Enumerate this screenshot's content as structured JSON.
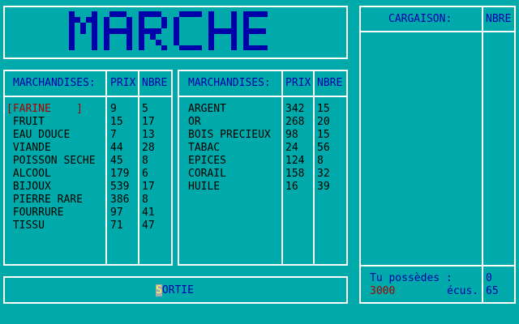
{
  "title": "MARCHE",
  "colors": {
    "background": "#00aaaa",
    "border": "#ffffff",
    "header_text": "#0000aa",
    "selected": "#aa0000",
    "money": "#aa0000",
    "title": "#0000aa"
  },
  "left_table": {
    "headers": {
      "item": "MARCHANDISES:",
      "price": "PRIX",
      "count": "NBRE"
    },
    "rows": [
      {
        "item": "[FARINE    ]",
        "price": "9",
        "count": "5",
        "selected": true
      },
      {
        "item": " FRUIT",
        "price": "15",
        "count": "17"
      },
      {
        "item": " EAU DOUCE",
        "price": "7",
        "count": "13"
      },
      {
        "item": " VIANDE",
        "price": "44",
        "count": "28"
      },
      {
        "item": " POISSON SECHE",
        "price": "45",
        "count": "8"
      },
      {
        "item": " ALCOOL",
        "price": "179",
        "count": "6"
      },
      {
        "item": " BIJOUX",
        "price": "539",
        "count": "17"
      },
      {
        "item": " PIERRE RARE",
        "price": "386",
        "count": "8"
      },
      {
        "item": " FOURRURE",
        "price": "97",
        "count": "41"
      },
      {
        "item": " TISSU",
        "price": "71",
        "count": "47"
      }
    ]
  },
  "right_table": {
    "headers": {
      "item": "MARCHANDISES:",
      "price": "PRIX",
      "count": "NBRE"
    },
    "rows": [
      {
        "item": "ARGENT",
        "price": "342",
        "count": "15"
      },
      {
        "item": "OR",
        "price": "268",
        "count": "20"
      },
      {
        "item": "BOIS PRECIEUX",
        "price": "98",
        "count": "15"
      },
      {
        "item": "TABAC",
        "price": "24",
        "count": "56"
      },
      {
        "item": "EPICES",
        "price": "124",
        "count": "8"
      },
      {
        "item": "CORAIL",
        "price": "158",
        "count": "32"
      },
      {
        "item": "HUILE",
        "price": "16",
        "count": "39"
      }
    ]
  },
  "cargo": {
    "header": "CARGAISON:",
    "count_header": "NBRE"
  },
  "wallet": {
    "label": "Tu possèdes :",
    "amount": "3000",
    "currency": "écus.",
    "value1": "0",
    "value2": "65"
  },
  "exit": {
    "hotkey": "S",
    "rest": "ORTIE"
  }
}
